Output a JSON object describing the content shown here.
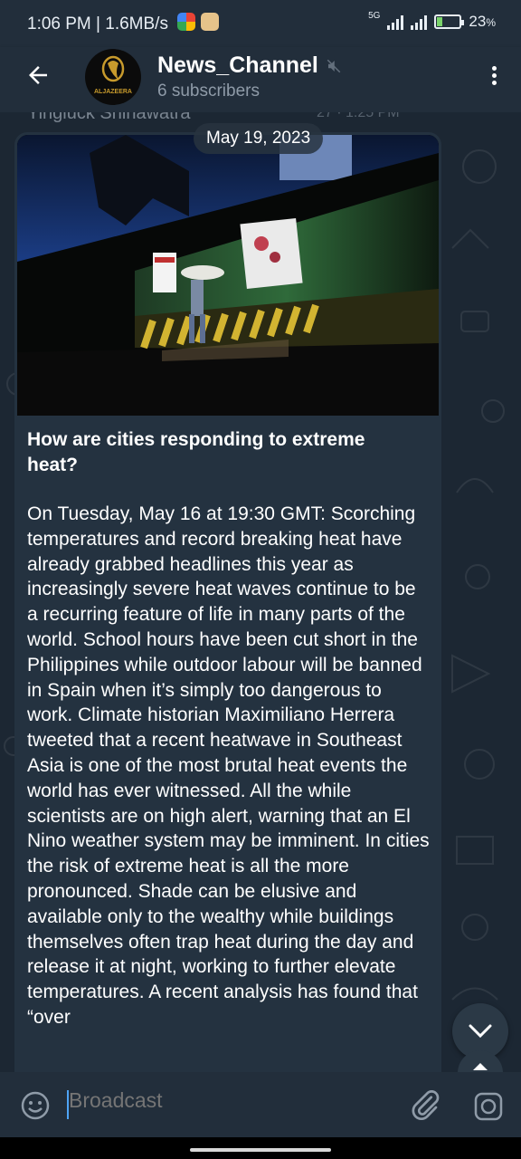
{
  "status_bar": {
    "time": "1:06 PM",
    "speed": "1.6MB/s",
    "network": "5G",
    "battery_percent": "23",
    "battery_suffix": "%",
    "battery_level": 0.23,
    "battery_color": "#7ad36b"
  },
  "header": {
    "channel_name": "News_Channel",
    "subscribers": "6 subscribers",
    "avatar_logo_text": "ALJAZEERA",
    "muted": true
  },
  "chat": {
    "previous_message_fragment": "Yingluck Shinawatra",
    "previous_message_time": "27 · 1:25 PM",
    "date_separator": "May 19, 2023",
    "message": {
      "title": "How are cities responding to extreme heat?",
      "body": "On Tuesday, May 16 at 19:30 GMT: Scorching temperatures and record breaking heat have already grabbed headlines this year as increasingly severe heat waves continue to be a recurring feature of life in many parts of the world. School hours have been cut short in the Philippines while outdoor labour will be banned in Spain when it’s simply too dangerous to work. Climate historian Maximiliano Herrera tweeted that a recent heatwave in Southeast Asia is one of the most brutal heat events the world has ever witnessed. All the while scientists are on high alert, warning that an El Nino weather system may be imminent. In cities the risk of extreme heat is all the more pronounced. Shade can be elusive and available only to the wealthy while buildings themselves often trap heat during the day and release it at night, working to further elevate temperatures. A recent analysis has found that “over"
    }
  },
  "composer": {
    "placeholder": "Broadcast"
  },
  "colors": {
    "accent": "#4ea4f6",
    "header_bg": "#222e3b",
    "bubble_bg": "#243240"
  }
}
